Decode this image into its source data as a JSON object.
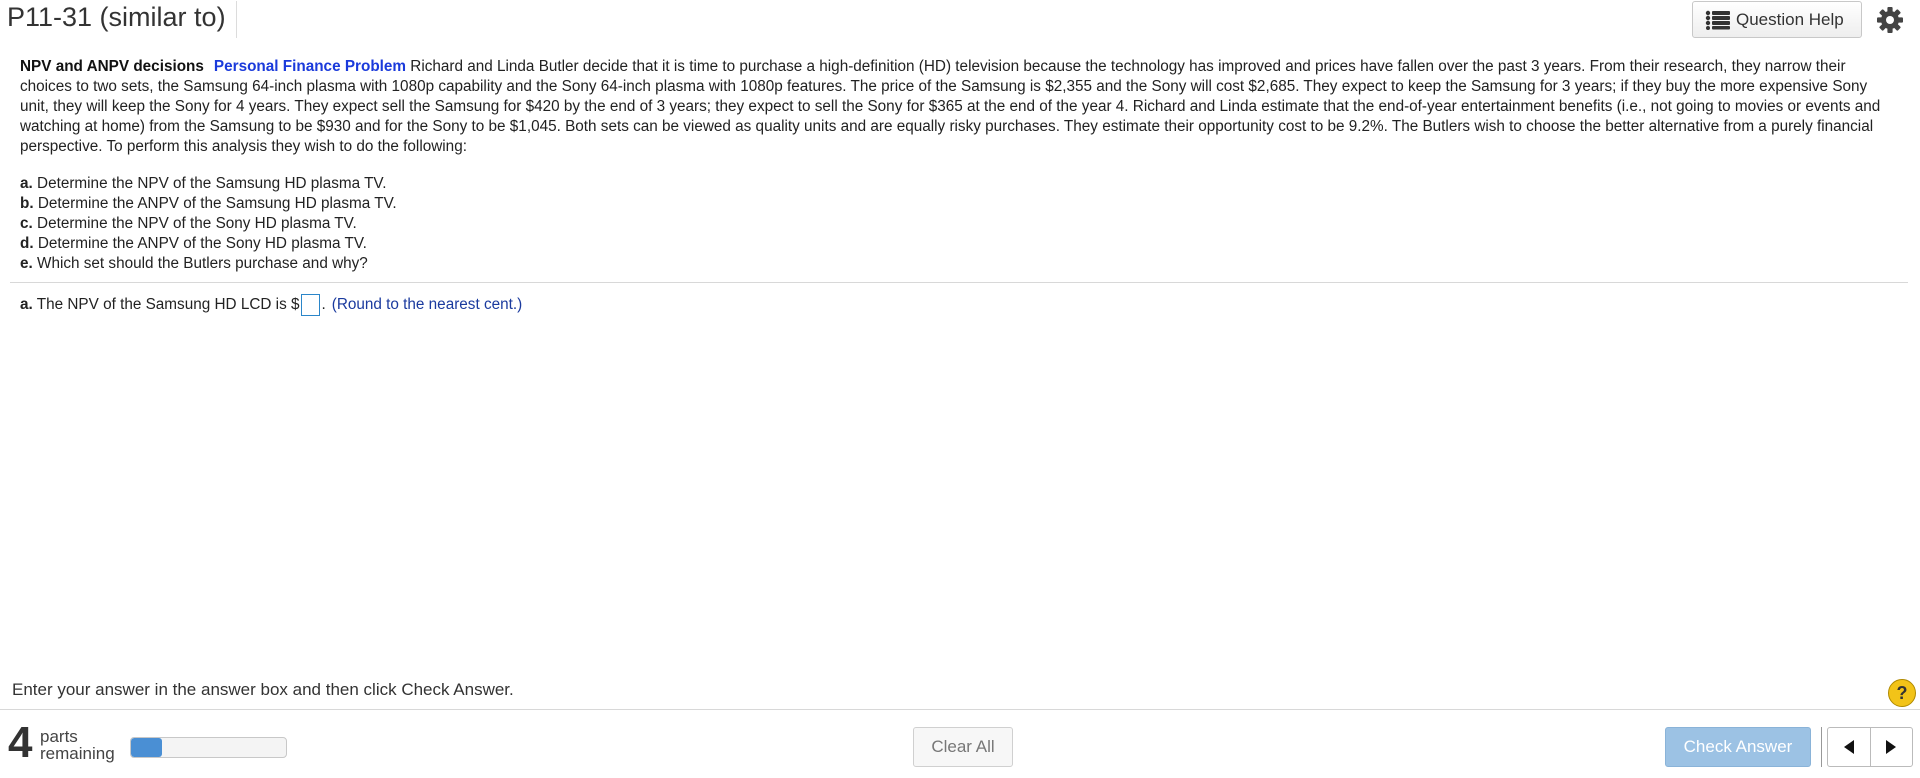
{
  "header": {
    "title": "P11-31 (similar to)",
    "help_label": "Question Help"
  },
  "problem": {
    "lead": "NPV and ANPV decisions",
    "category": "Personal Finance Problem",
    "text": " Richard and Linda Butler decide that it is time to purchase a high-definition (HD) television because the technology has improved and prices have fallen over the past 3 years. From their research, they narrow their choices to two sets, the Samsung 64-inch plasma with 1080p capability and the Sony 64-inch plasma with 1080p features.  The price of the Samsung is $2,355 and the Sony will cost $2,685. They expect to keep the Samsung for 3 years; if they buy the more expensive Sony unit, they will keep the Sony for 4 years.  They expect  sell the Samsung for $420 by the end of 3 years; they expect to sell the Sony for $365 at the end of the year 4.  Richard and Linda estimate that the end-of-year entertainment benefits (i.e., not going to movies or events and watching at home) from the Samsung to be $930 and for the Sony to be $1,045. Both sets can be viewed as quality units and are equally risky purchases.  They estimate their opportunity cost to be 9.2%.  The Butlers wish to choose the better alternative from a purely financial perspective.  To perform this analysis they wish to do the following:"
  },
  "parts": [
    {
      "letter": "a.",
      "text": "Determine the NPV of the Samsung HD plasma TV."
    },
    {
      "letter": "b.",
      "text": "Determine the ANPV of the Samsung HD plasma TV."
    },
    {
      "letter": "c.",
      "text": "Determine the NPV of the Sony HD plasma TV."
    },
    {
      "letter": "d.",
      "text": "Determine the ANPV of the Sony HD plasma TV."
    },
    {
      "letter": "e.",
      "text": "Which set should the Butlers purchase and why?"
    }
  ],
  "answer": {
    "letter": "a.",
    "prefix": "The NPV of the Samsung HD LCD is $",
    "value": "",
    "suffix": ".",
    "hint": "(Round to the nearest cent.)"
  },
  "footer": {
    "instructions": "Enter your answer in the answer box and then click Check Answer.",
    "help_symbol": "?",
    "parts_count": "4",
    "parts_word": "parts",
    "remaining_word": "remaining",
    "progress_fraction": 0.2,
    "clear_label": "Clear All",
    "check_label": "Check Answer"
  },
  "colors": {
    "accent": "#1a3adb",
    "progress": "#4a8fd4",
    "check_button": "#9cc2e4",
    "help_badge": "#f2c318"
  },
  "icons": {
    "help_list": "list-icon",
    "settings": "gear-icon",
    "prev": "triangle-left-icon",
    "next": "triangle-right-icon"
  }
}
